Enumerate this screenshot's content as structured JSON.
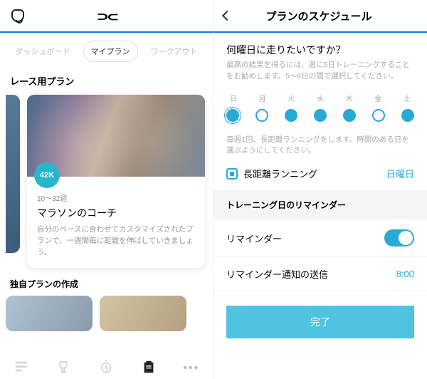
{
  "left": {
    "tabs": [
      "ダッシュボード",
      "マイプラン",
      "ワークアウト"
    ],
    "section1": "レース用プラン",
    "card": {
      "badge": "42K",
      "weeks": "10〜32週",
      "title": "マラソンのコーチ",
      "desc": "自分のペースに合わせてカスタマイズされたプランで、一週間毎に距離を伸ばしていきましょう。"
    },
    "section2": "独自プランの作成"
  },
  "right": {
    "title": "プランのスケジュール",
    "question": "何曜日に走りたいですか？",
    "hint": "最高の結果を得るには、週に5日トレーニングすることをお勧めします。5〜6日の間で選択してください。",
    "days": [
      "日",
      "月",
      "火",
      "水",
      "木",
      "金",
      "土"
    ],
    "hint2": "毎週1回、長距離ランニングをします。時間のある日を選ぶようにしてください。",
    "long_label": "長距離ランニング",
    "long_day": "日曜日",
    "reminder_sect": "トレーニング日のリマインダー",
    "reminder": "リマインダー",
    "notify": "リマインダー通知の送信",
    "time": "8:00",
    "done": "完了"
  }
}
